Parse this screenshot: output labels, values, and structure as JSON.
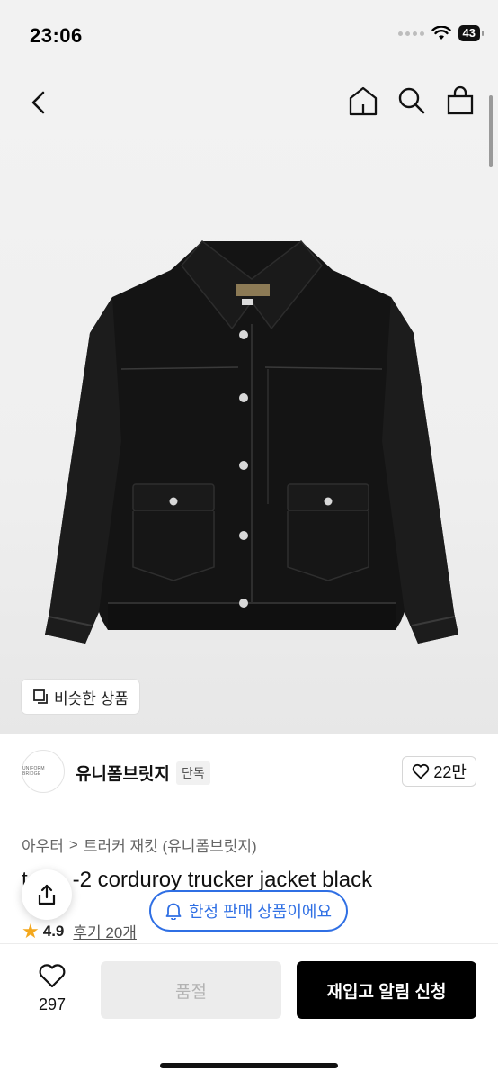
{
  "status": {
    "time": "23:06",
    "battery": "43"
  },
  "nav": {
    "back": "chevron-left-icon",
    "icons": [
      "home-icon",
      "search-icon",
      "shopping-bag-icon"
    ]
  },
  "hero": {
    "similar_label": "비슷한 상품"
  },
  "seller": {
    "logo_text": "UNIFORM BRIDGE",
    "name": "유니폼브릿지",
    "badge": "단독",
    "likes": "22만"
  },
  "breadcrumb": {
    "category": "아우터",
    "separator": ">",
    "subcategory": "트러커 재킷 (유니폼브릿지)"
  },
  "product": {
    "title_prefix": "t",
    "title_visible": "-2 corduroy trucker jacket black",
    "rating": "4.9",
    "reviews": "후기 20개"
  },
  "floating": {
    "limited_label": "한정 판매 상품이에요"
  },
  "bottom": {
    "like_count": "297",
    "soldout_label": "품절",
    "restock_label": "재입고 알림 신청"
  },
  "colors": {
    "accent": "#2f6fe4",
    "star": "#f4a81d",
    "primary_button": "#000000"
  }
}
